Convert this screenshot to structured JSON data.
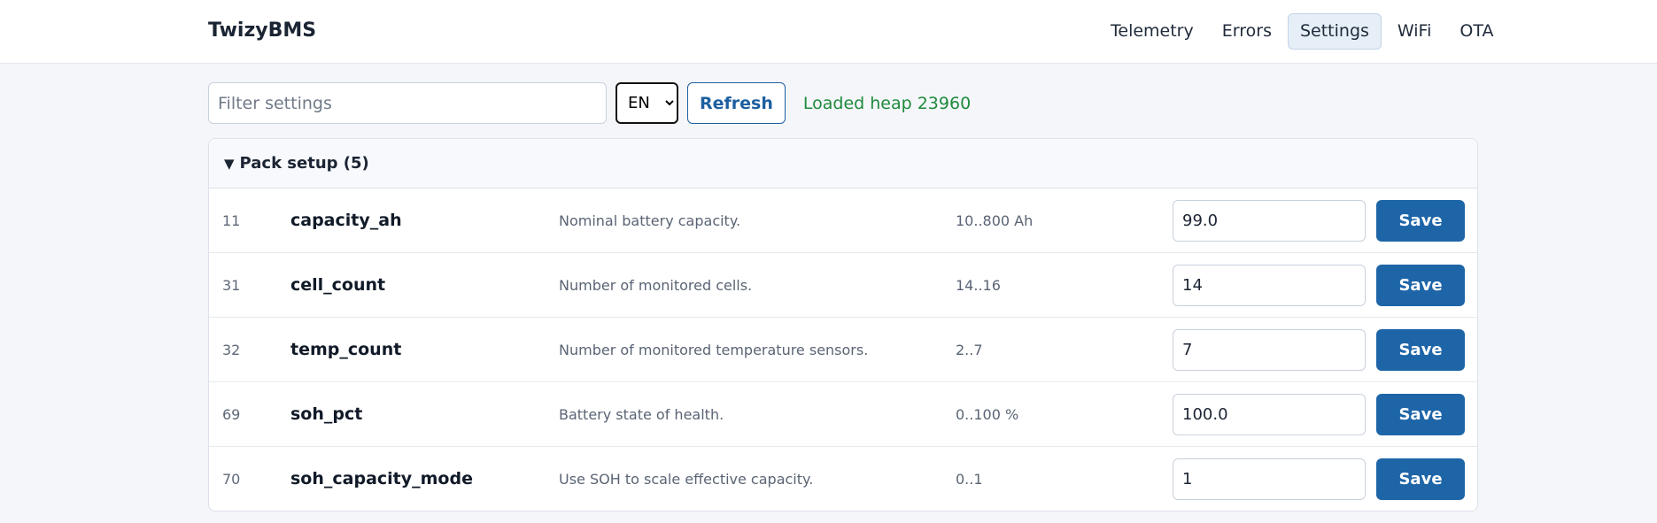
{
  "app": {
    "title": "TwizyBMS"
  },
  "nav": {
    "items": [
      {
        "label": "Telemetry",
        "active": false
      },
      {
        "label": "Errors",
        "active": false
      },
      {
        "label": "Settings",
        "active": true
      },
      {
        "label": "WiFi",
        "active": false
      },
      {
        "label": "OTA",
        "active": false
      }
    ]
  },
  "toolbar": {
    "filter_placeholder": "Filter settings",
    "filter_value": "",
    "language": "EN",
    "language_options": [
      "EN"
    ],
    "refresh_label": "Refresh",
    "status": "Loaded heap 23960"
  },
  "group": {
    "caret": "▼",
    "title": "Pack setup (5)",
    "rows": [
      {
        "id": "11",
        "name": "capacity_ah",
        "desc": "Nominal battery capacity.",
        "range": "10..800 Ah",
        "value": "99.0",
        "save": "Save"
      },
      {
        "id": "31",
        "name": "cell_count",
        "desc": "Number of monitored cells.",
        "range": "14..16",
        "value": "14",
        "save": "Save"
      },
      {
        "id": "32",
        "name": "temp_count",
        "desc": "Number of monitored temperature sensors.",
        "range": "2..7",
        "value": "7",
        "save": "Save"
      },
      {
        "id": "69",
        "name": "soh_pct",
        "desc": "Battery state of health.",
        "range": "0..100 %",
        "value": "100.0",
        "save": "Save"
      },
      {
        "id": "70",
        "name": "soh_capacity_mode",
        "desc": "Use SOH to scale effective capacity.",
        "range": "0..1",
        "value": "1",
        "save": "Save"
      }
    ]
  },
  "colors": {
    "accent": "#1e65a8",
    "status_ok": "#1f8a3c",
    "active_tab_bg": "#e6eef8"
  }
}
